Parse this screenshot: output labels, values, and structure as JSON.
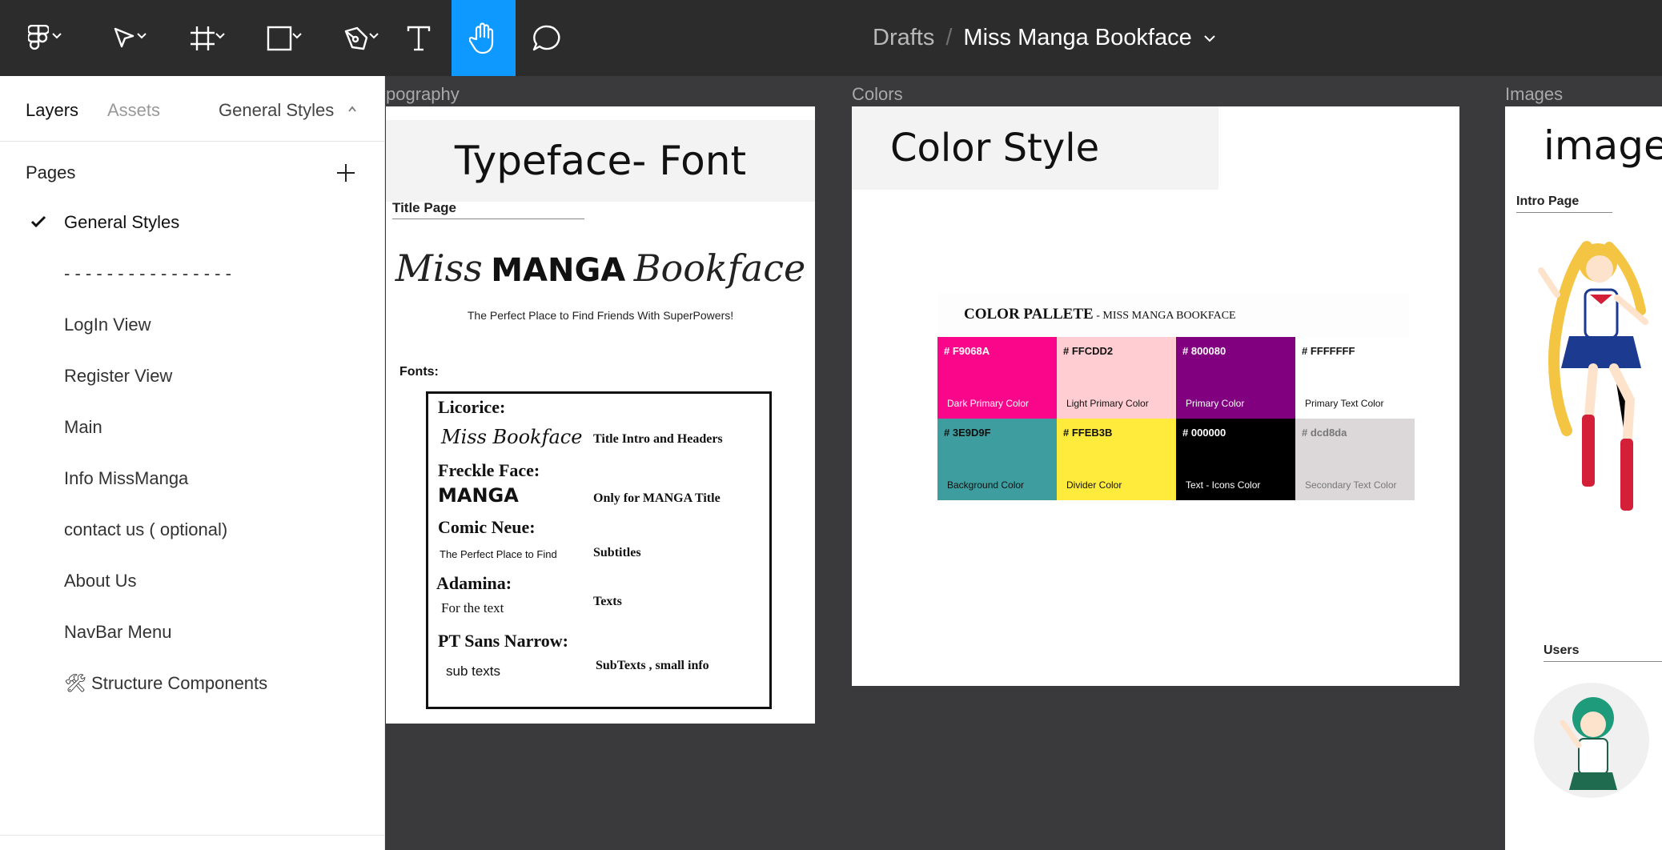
{
  "toolbar": {
    "breadcrumb_root": "Drafts",
    "separator": "/",
    "file_name": "Miss Manga Bookface",
    "active_tool": "hand-tool",
    "accent": "#0d99ff"
  },
  "left_panel": {
    "tabs": {
      "layers": "Layers",
      "assets": "Assets",
      "current_page": "General Styles"
    },
    "pages_heading": "Pages",
    "pages": [
      {
        "label": "General Styles",
        "selected": true
      },
      {
        "label": "- - - - - - - - - - - - - - - -",
        "selected": false
      },
      {
        "label": "LogIn View",
        "selected": false
      },
      {
        "label": "Register View",
        "selected": false
      },
      {
        "label": "Main",
        "selected": false
      },
      {
        "label": "Info MissManga",
        "selected": false
      },
      {
        "label": "contact us ( optional)",
        "selected": false
      },
      {
        "label": "About Us",
        "selected": false
      },
      {
        "label": "NavBar Menu",
        "selected": false
      },
      {
        "label": "🛠 Structure Components",
        "selected": false
      }
    ]
  },
  "canvas": {
    "typography": {
      "frame_label": "pography",
      "banner_title": "Typeface- Font",
      "title_page_label": "Title Page",
      "brand": {
        "script_left": "Miss",
        "bold": "MANGA",
        "script_right": "Bookface"
      },
      "tagline": "The Perfect Place to Find Friends With SuperPowers!",
      "fonts_label": "Fonts:",
      "fonts": [
        {
          "name": "Licorice:",
          "sample": "Miss Bookface",
          "use": "Title Intro and Headers"
        },
        {
          "name": "Freckle Face:",
          "sample": "MANGA",
          "use": "Only for MANGA Title"
        },
        {
          "name": "Comic Neue:",
          "sample": "The Perfect Place to Find",
          "use": "Subtitles"
        },
        {
          "name": "Adamina:",
          "sample": "For the text",
          "use": "Texts"
        },
        {
          "name": "PT Sans Narrow:",
          "sample": "sub texts",
          "use": "SubTexts , small info"
        }
      ]
    },
    "colors": {
      "frame_label": "Colors",
      "banner_title": "Color Style",
      "palette_title": "COLOR PALLETE",
      "palette_subtitle": " - MISS MANGA BOOKFACE",
      "swatches": [
        {
          "hex": "# F9068A",
          "name": "Dark Primary Color",
          "color": "#F9068A",
          "text": "#ffffff"
        },
        {
          "hex": "# FFCDD2",
          "name": "Light Primary Color",
          "color": "#FFCDD2",
          "text": "#111111"
        },
        {
          "hex": "# 800080",
          "name": "Primary Color",
          "color": "#800080",
          "text": "#ffffff"
        },
        {
          "hex": "# FFFFFFF",
          "name": "Primary Text Color",
          "color": "#FFFFFF",
          "text": "#111111"
        },
        {
          "hex": "# 3E9D9F",
          "name": "Background Color",
          "color": "#3E9D9F",
          "text": "#111111"
        },
        {
          "hex": "# FFEB3B",
          "name": "Divider Color",
          "color": "#FFEB3B",
          "text": "#111111"
        },
        {
          "hex": "# 000000",
          "name": "Text - Icons Color",
          "color": "#000000",
          "text": "#ffffff"
        },
        {
          "hex": "# dcd8da",
          "name": "Secondary Text Color",
          "color": "#dcd8da",
          "text": "#777777"
        }
      ]
    },
    "images": {
      "frame_label": "Images",
      "title": "images",
      "intro_label": "Intro Page",
      "users_label": "Users"
    }
  }
}
